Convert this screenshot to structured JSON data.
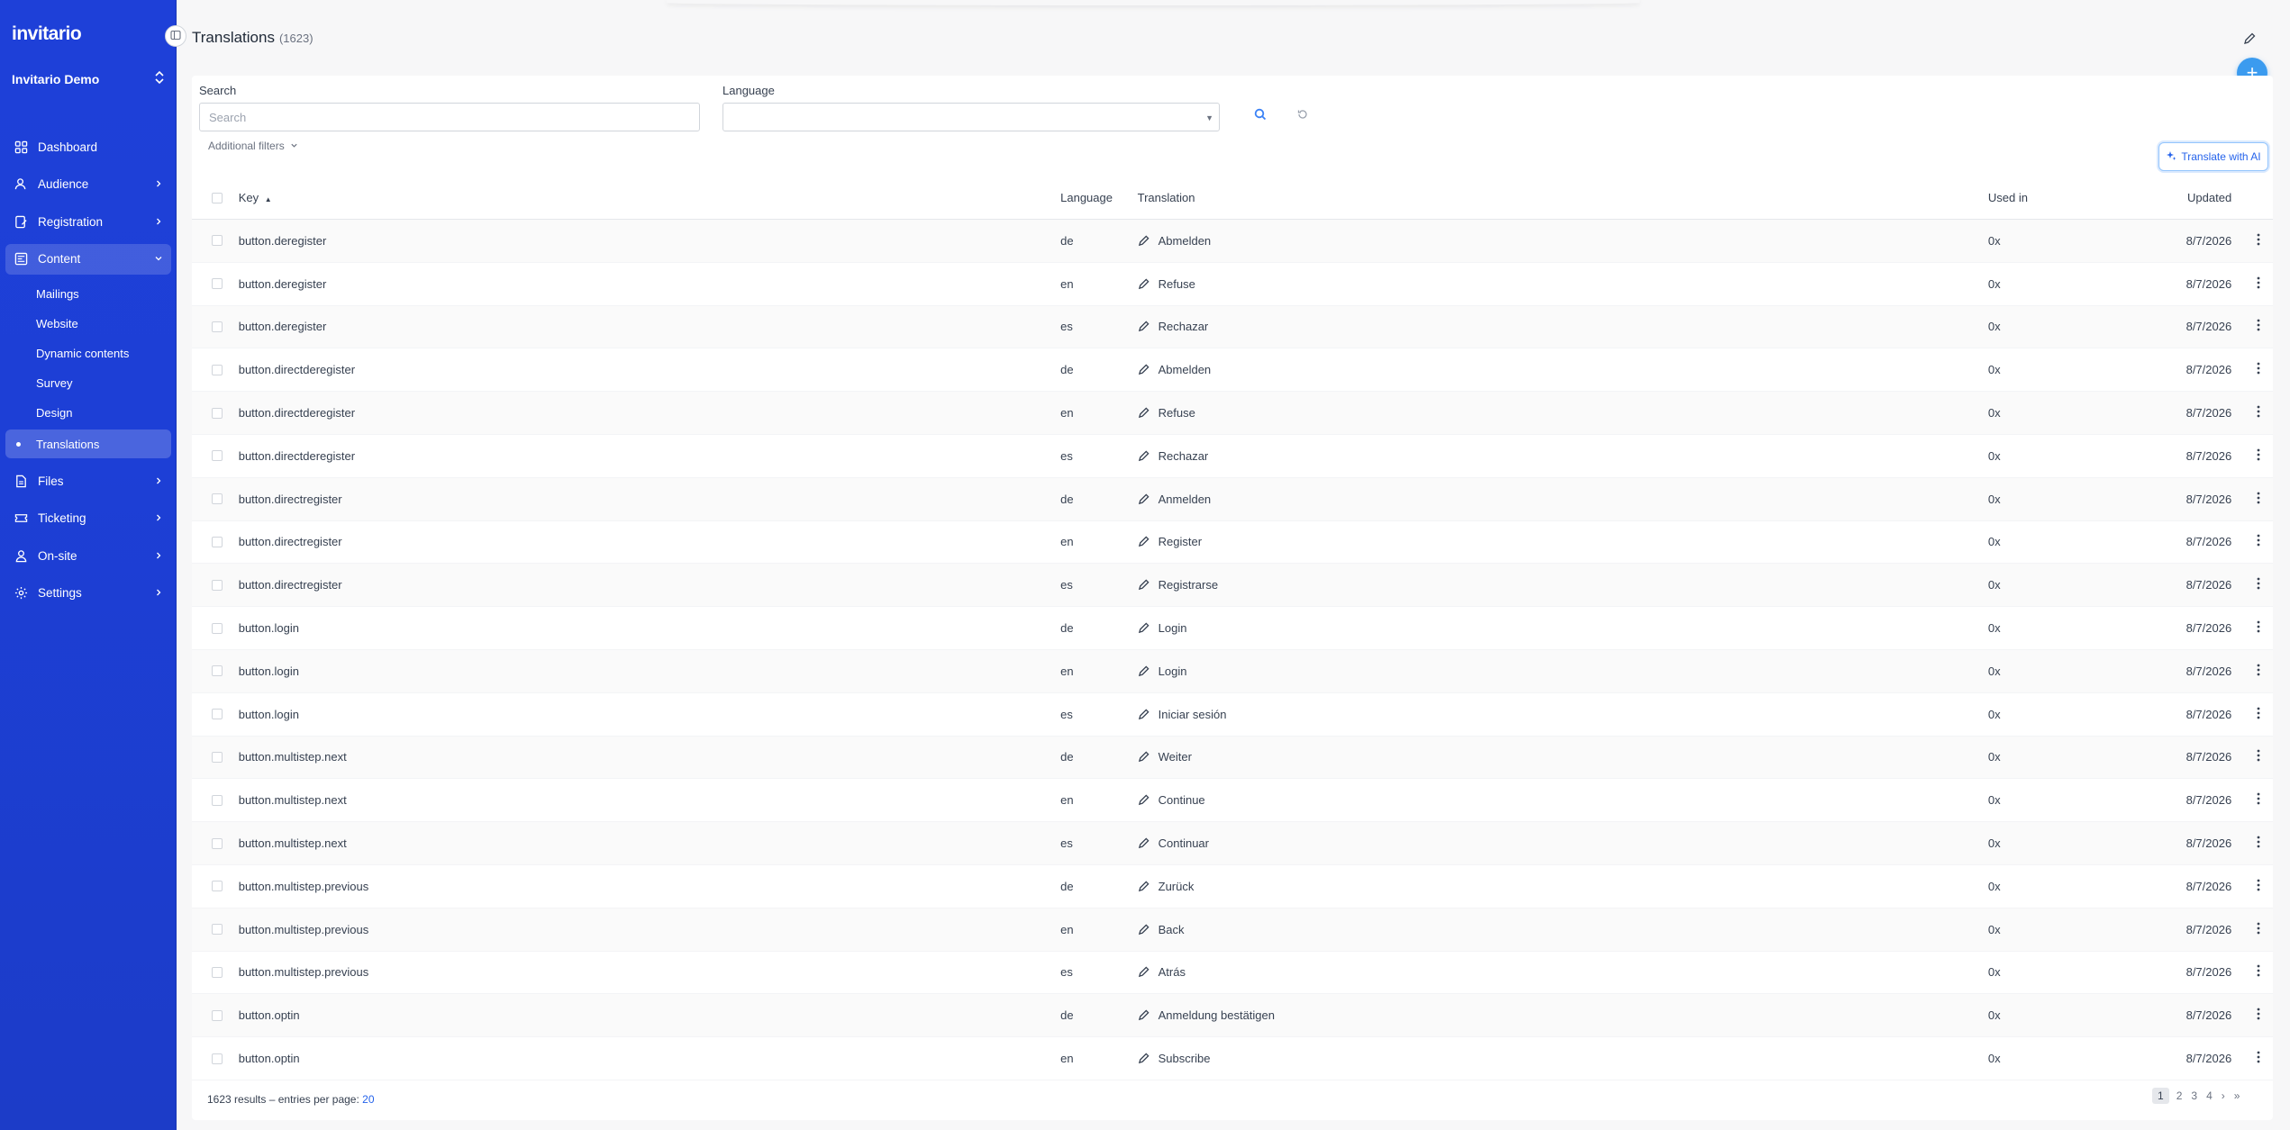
{
  "app": {
    "logo": "invitario",
    "workspace": "Invitario Demo"
  },
  "sidebar": {
    "items": [
      {
        "label": "Dashboard",
        "icon": "dashboard-icon",
        "chevron": false
      },
      {
        "label": "Audience",
        "icon": "users-icon",
        "chevron": true
      },
      {
        "label": "Registration",
        "icon": "registration-icon",
        "chevron": true
      },
      {
        "label": "Content",
        "icon": "content-icon",
        "chevron": true,
        "open": true
      }
    ],
    "content_sub": [
      "Mailings",
      "Website",
      "Dynamic contents",
      "Survey",
      "Design"
    ],
    "active_sub": "Translations",
    "items_after": [
      {
        "label": "Files",
        "icon": "file-icon"
      },
      {
        "label": "Ticketing",
        "icon": "ticket-icon"
      },
      {
        "label": "On-site",
        "icon": "onsite-user-icon"
      },
      {
        "label": "Settings",
        "icon": "gear-icon"
      }
    ]
  },
  "header": {
    "title": "Translations",
    "count": "(1623)"
  },
  "filters": {
    "search_label": "Search",
    "search_placeholder": "Search",
    "language_label": "Language",
    "additional_filters": "Additional filters",
    "ai_button": "Translate with AI"
  },
  "table": {
    "headers": {
      "key": "Key",
      "language": "Language",
      "translation": "Translation",
      "used_in": "Used in",
      "updated": "Updated"
    },
    "rows": [
      {
        "key": "button.deregister",
        "lang": "de",
        "translation": "Abmelden",
        "used": "0x",
        "updated": "8/7/2026"
      },
      {
        "key": "button.deregister",
        "lang": "en",
        "translation": "Refuse",
        "used": "0x",
        "updated": "8/7/2026"
      },
      {
        "key": "button.deregister",
        "lang": "es",
        "translation": "Rechazar",
        "used": "0x",
        "updated": "8/7/2026"
      },
      {
        "key": "button.directderegister",
        "lang": "de",
        "translation": "Abmelden",
        "used": "0x",
        "updated": "8/7/2026"
      },
      {
        "key": "button.directderegister",
        "lang": "en",
        "translation": "Refuse",
        "used": "0x",
        "updated": "8/7/2026"
      },
      {
        "key": "button.directderegister",
        "lang": "es",
        "translation": "Rechazar",
        "used": "0x",
        "updated": "8/7/2026"
      },
      {
        "key": "button.directregister",
        "lang": "de",
        "translation": "Anmelden",
        "used": "0x",
        "updated": "8/7/2026"
      },
      {
        "key": "button.directregister",
        "lang": "en",
        "translation": "Register",
        "used": "0x",
        "updated": "8/7/2026"
      },
      {
        "key": "button.directregister",
        "lang": "es",
        "translation": "Registrarse",
        "used": "0x",
        "updated": "8/7/2026"
      },
      {
        "key": "button.login",
        "lang": "de",
        "translation": "Login",
        "used": "0x",
        "updated": "8/7/2026"
      },
      {
        "key": "button.login",
        "lang": "en",
        "translation": "Login",
        "used": "0x",
        "updated": "8/7/2026"
      },
      {
        "key": "button.login",
        "lang": "es",
        "translation": "Iniciar sesión",
        "used": "0x",
        "updated": "8/7/2026"
      },
      {
        "key": "button.multistep.next",
        "lang": "de",
        "translation": "Weiter",
        "used": "0x",
        "updated": "8/7/2026"
      },
      {
        "key": "button.multistep.next",
        "lang": "en",
        "translation": "Continue",
        "used": "0x",
        "updated": "8/7/2026"
      },
      {
        "key": "button.multistep.next",
        "lang": "es",
        "translation": "Continuar",
        "used": "0x",
        "updated": "8/7/2026"
      },
      {
        "key": "button.multistep.previous",
        "lang": "de",
        "translation": "Zurück",
        "used": "0x",
        "updated": "8/7/2026"
      },
      {
        "key": "button.multistep.previous",
        "lang": "en",
        "translation": "Back",
        "used": "0x",
        "updated": "8/7/2026"
      },
      {
        "key": "button.multistep.previous",
        "lang": "es",
        "translation": "Atrás",
        "used": "0x",
        "updated": "8/7/2026"
      },
      {
        "key": "button.optin",
        "lang": "de",
        "translation": "Anmeldung bestätigen",
        "used": "0x",
        "updated": "8/7/2026"
      },
      {
        "key": "button.optin",
        "lang": "en",
        "translation": "Subscribe",
        "used": "0x",
        "updated": "8/7/2026"
      }
    ]
  },
  "footer": {
    "results": "1623 results",
    "separator": "–",
    "entries_label": "entries per page:",
    "per_page": "20"
  },
  "pagination": {
    "pages": [
      "1",
      "2",
      "3",
      "4"
    ],
    "next": "›",
    "last": "»"
  },
  "colors": {
    "sidebar": "#1e40d8",
    "accent": "#3b9bef",
    "link": "#2563eb"
  }
}
